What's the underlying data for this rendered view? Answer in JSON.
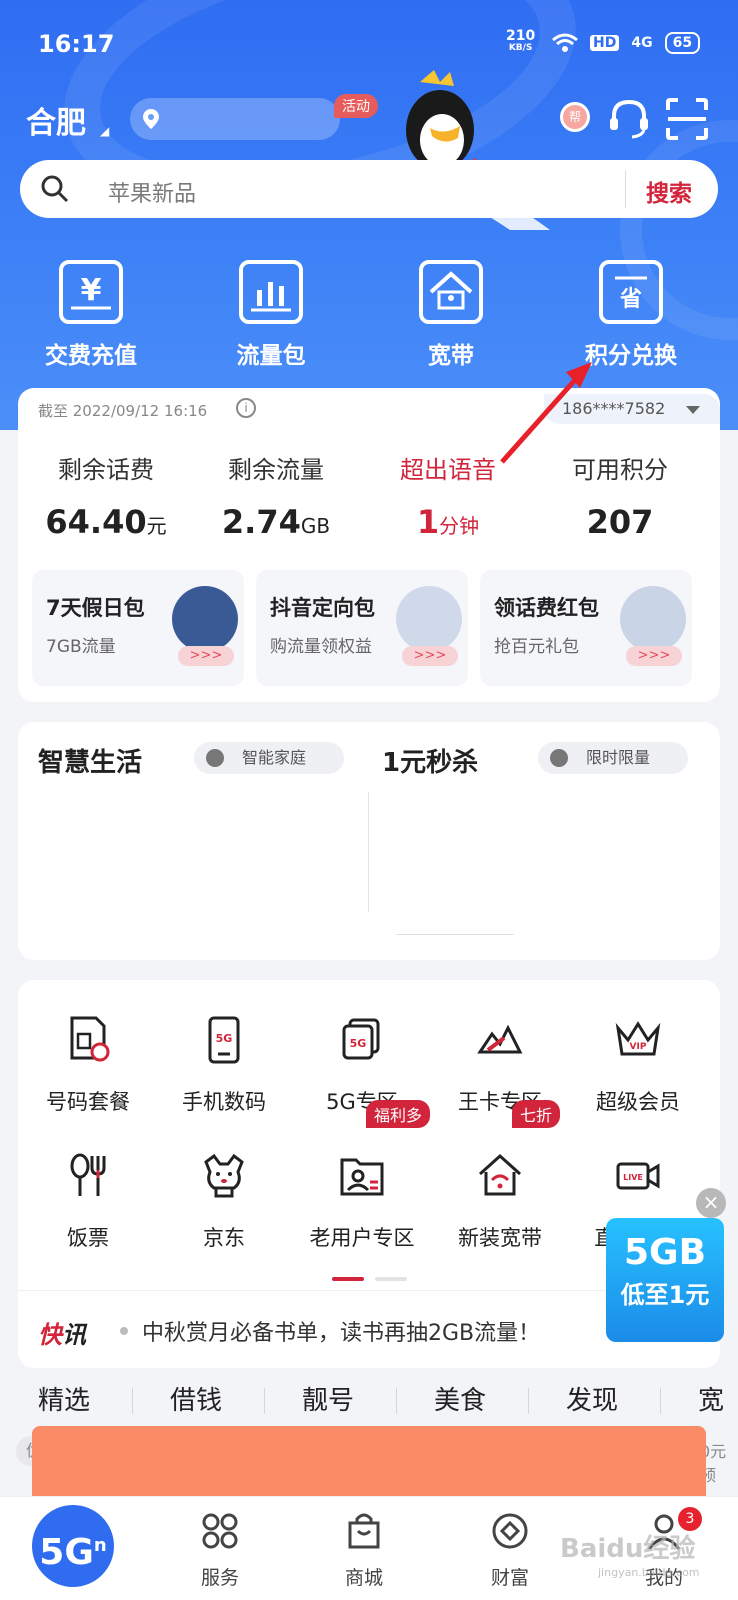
{
  "status_bar": {
    "time": "16:17",
    "net_speed": "210",
    "net_unit": "KB/S",
    "hd": "HD",
    "signal": "4G",
    "battery": "65"
  },
  "header": {
    "city": "合肥",
    "activity_tag": "活动",
    "coin_label": "帮"
  },
  "search": {
    "placeholder": "苹果新品",
    "button": "搜索"
  },
  "quick_actions": [
    {
      "label": "交费充值",
      "icon": "yen-icon"
    },
    {
      "label": "流量包",
      "icon": "bar-chart-icon"
    },
    {
      "label": "宽带",
      "icon": "house-network-icon"
    },
    {
      "label": "积分兑换",
      "icon": "save-coupon-icon"
    }
  ],
  "balance": {
    "as_of": "截至 2022/09/12 16:16",
    "phone": "186****7582",
    "stats": [
      {
        "label": "剩余话费",
        "value": "64.40",
        "unit": "元"
      },
      {
        "label": "剩余流量",
        "value": "2.74",
        "unit": "GB"
      },
      {
        "label": "超出语音",
        "value": "1",
        "unit": "分钟"
      },
      {
        "label": "可用积分",
        "value": "207",
        "unit": ""
      }
    ],
    "promos": [
      {
        "title": "7天假日包",
        "sub": "7GB流量",
        "arrow": ">>>"
      },
      {
        "title": "抖音定向包",
        "sub": "购流量领权益",
        "arrow": ">>>"
      },
      {
        "title": "领话费红包",
        "sub": "抢百元礼包",
        "arrow": ">>>"
      }
    ]
  },
  "life": {
    "title": "智慧生活",
    "tag": "智能家庭",
    "flash_title": "1元秒杀",
    "flash_tag": "限时限量"
  },
  "services": [
    {
      "label": "号码套餐"
    },
    {
      "label": "手机数码"
    },
    {
      "label": "5G专区"
    },
    {
      "label": "王卡专区"
    },
    {
      "label": "超级会员"
    },
    {
      "label": "饭票"
    },
    {
      "label": "京东"
    },
    {
      "label": "老用户专区"
    },
    {
      "label": "新装宽带"
    },
    {
      "label": "直播LIVE"
    }
  ],
  "service_badges": {
    "old_user": "福利多",
    "broadband": "七折"
  },
  "news": {
    "logo_a": "快",
    "logo_b": "讯",
    "text": "中秋赏月必备书单，读书再抽2GB流量！"
  },
  "float_ad": {
    "line1": "5GB",
    "line2": "低至1元"
  },
  "tabs": [
    "精选",
    "借钱",
    "靓号",
    "美食",
    "发现",
    "宽"
  ],
  "sub_left": "优质",
  "sub_right": "0元预",
  "bottom_nav": {
    "home": "5G",
    "home_sup": "n",
    "items": [
      {
        "label": "服务"
      },
      {
        "label": "商城"
      },
      {
        "label": "财富"
      },
      {
        "label": "我的"
      }
    ],
    "badge": "3"
  },
  "watermark": {
    "main": "Baidu经验",
    "sub": "jingyan.baidu.com"
  },
  "colors": {
    "brand_blue": "#2f6df2",
    "accent_red": "#d2253b",
    "annotation": "#e8202a"
  }
}
